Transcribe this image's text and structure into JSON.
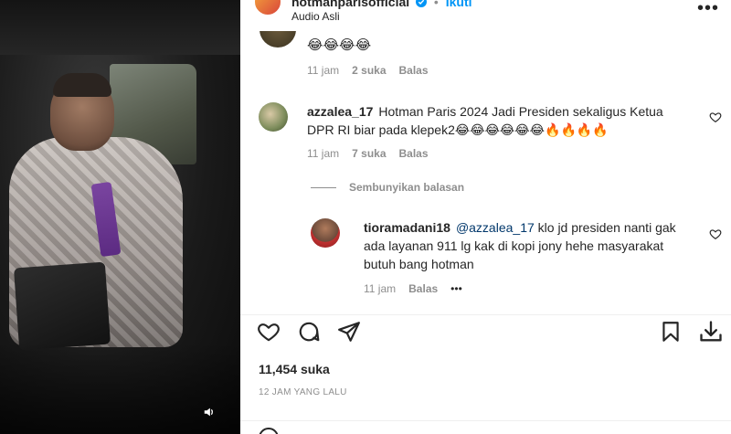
{
  "header": {
    "username": "hotmanparisofficial",
    "verified": true,
    "follow_label": "Ikuti",
    "audio_label": "Audio Asli"
  },
  "comments": [
    {
      "text": "😂😂😂😂",
      "time": "11 jam",
      "likes": "2 suka",
      "reply_label": "Balas"
    },
    {
      "username": "azzalea_17",
      "text": "Hotman Paris 2024 Jadi Presiden sekaligus Ketua DPR RI biar pada klepek2😂😂😂😂😂😂🔥🔥🔥🔥",
      "time": "11 jam",
      "likes": "7 suka",
      "reply_label": "Balas",
      "hide_replies_label": "Sembunyikan balasan"
    },
    {
      "username": "tioramadani18",
      "mention": "@azzalea_17",
      "text": "klo jd presiden nanti gak ada layanan 911 lg kak di kopi jony hehe masyarakat butuh bang hotman",
      "time": "11 jam",
      "reply_label": "Balas",
      "more_label": "•••"
    }
  ],
  "post": {
    "likes": "11,454 suka",
    "timestamp": "12 JAM YANG LALU"
  },
  "icons": {
    "like": "heart-icon",
    "comment": "comment-icon",
    "share": "send-icon",
    "save": "bookmark-icon",
    "download": "download-icon",
    "volume": "speaker-icon",
    "more": "more-icon"
  },
  "colors": {
    "text": "#262626",
    "muted": "#8e8e8e",
    "link": "#00376b",
    "verified": "#0095f6"
  }
}
